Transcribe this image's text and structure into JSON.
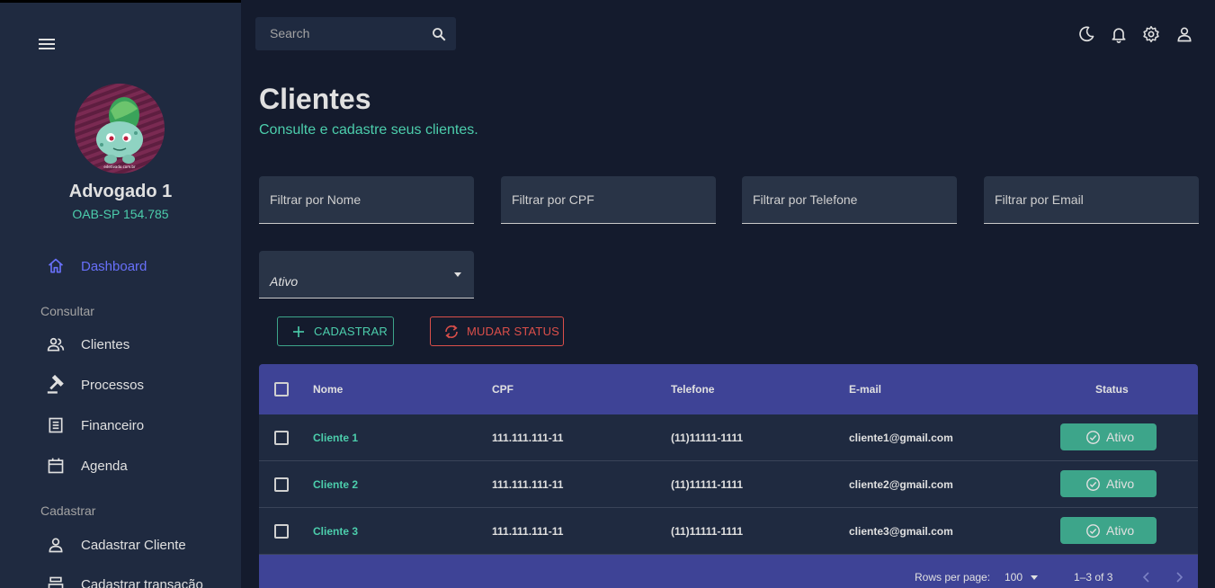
{
  "sidebar": {
    "user_name": "Advogado 1",
    "user_oab": "OAB-SP 154.785",
    "avatar_caption": "edetivado.com.br",
    "dashboard": "Dashboard",
    "section_consultar": "Consultar",
    "items_consultar": [
      "Clientes",
      "Processos",
      "Financeiro",
      "Agenda"
    ],
    "section_cadastrar": "Cadastrar",
    "items_cadastrar": [
      "Cadastrar Cliente",
      "Cadastrar transação"
    ]
  },
  "topbar": {
    "search_placeholder": "Search",
    "icons": [
      "moon-icon",
      "bell-icon",
      "gear-icon",
      "person-icon"
    ]
  },
  "header": {
    "title": "Clientes",
    "subtitle": "Consulte e cadastre seus clientes."
  },
  "filters": {
    "name_placeholder": "Filtrar por Nome",
    "cpf_placeholder": "Filtrar por CPF",
    "phone_placeholder": "Filtrar por Telefone",
    "email_placeholder": "Filtrar por Email",
    "status_value": "Ativo"
  },
  "actions": {
    "register_label": "CADASTRAR",
    "change_status_label": "MUDAR STATUS"
  },
  "table": {
    "columns": [
      "Nome",
      "CPF",
      "Telefone",
      "E-mail",
      "Status"
    ],
    "rows": [
      {
        "name": "Cliente 1",
        "cpf": "111.111.111-11",
        "phone": "(11)11111-1111",
        "email": "cliente1@gmail.com",
        "status": "Ativo"
      },
      {
        "name": "Cliente 2",
        "cpf": "111.111.111-11",
        "phone": "(11)11111-1111",
        "email": "cliente2@gmail.com",
        "status": "Ativo"
      },
      {
        "name": "Cliente 3",
        "cpf": "111.111.111-11",
        "phone": "(11)11111-1111",
        "email": "cliente3@gmail.com",
        "status": "Ativo"
      }
    ],
    "rows_per_page_label": "Rows per page:",
    "rows_per_page_value": "100",
    "pagination_range": "1–3 of 3"
  },
  "colors": {
    "background": "#141b2d",
    "sidebar": "#1f2a40",
    "accent_green": "#4cceac",
    "accent_blue": "#6870fa",
    "table_header": "#3e4396",
    "danger": "#db4f4a"
  }
}
